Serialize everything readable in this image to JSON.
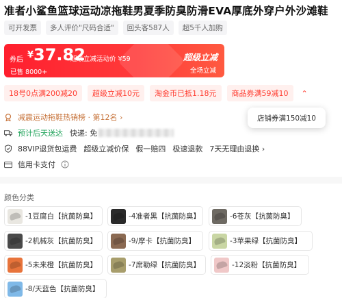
{
  "product": {
    "title": "准者小鲨鱼篮球运动凉拖鞋男夏季防臭防滑EVA厚底外穿户外沙滩鞋"
  },
  "tags": [
    "可开发票",
    "多人评价\"尺码合适\"",
    "回头客587人",
    "超5千人加购"
  ],
  "price_banner": {
    "prefix": "券后",
    "currency": "¥",
    "price": "37.82",
    "promo": "超级立减活动价 ¥59",
    "sold": "已售 8000+",
    "right_title": "超级立减",
    "right_sub": "全场立减",
    "accent": "#ff2a33"
  },
  "coupons": [
    "18号0点满200减20",
    "超级立减10元",
    "淘金币已抵1.18元",
    "商品券满59减10"
  ],
  "coupon_more_icon": "chevron-up-icon",
  "info": {
    "rank": "减震运动拖鞋热销榜 · 第12名 ›",
    "ship_tag": "预计后天送达",
    "ship_text": "快递: 免",
    "services": [
      "88VIP退货包运费",
      "超级立减价保",
      "假一赔四",
      "极速退款",
      "7天无理由退换 ›"
    ],
    "pay": "信用卡支付",
    "pay_info_icon": "info-icon"
  },
  "tooltip": "店铺券满150减10",
  "colors_section": {
    "title": "颜色分类",
    "items": [
      {
        "label": "-1豆腐白【抗菌防臭】",
        "color": "#e9e7e1"
      },
      {
        "label": "-4准者黑【抗菌防臭】",
        "color": "#2a2a2a"
      },
      {
        "label": "-6苍灰【抗菌防臭】",
        "color": "#6e6a63"
      },
      {
        "label": "-2机械灰【抗菌防臭】",
        "color": "#4a4a4a"
      },
      {
        "label": "-9/摩卡【抗菌防臭】",
        "color": "#8b6a52"
      },
      {
        "label": "-3苹果绿【抗菌防臭】",
        "color": "#c9d6a4"
      },
      {
        "label": "-5未来橙【抗菌防臭】",
        "color": "#e8743b"
      },
      {
        "label": "-7席勒绿【抗菌防臭】",
        "color": "#a89e6c"
      },
      {
        "label": "-12淡粉【抗菌防臭】",
        "color": "#f0c8c8"
      },
      {
        "label": "-8/天蓝色【抗菌防臭】",
        "color": "#7fb9e8"
      }
    ]
  }
}
